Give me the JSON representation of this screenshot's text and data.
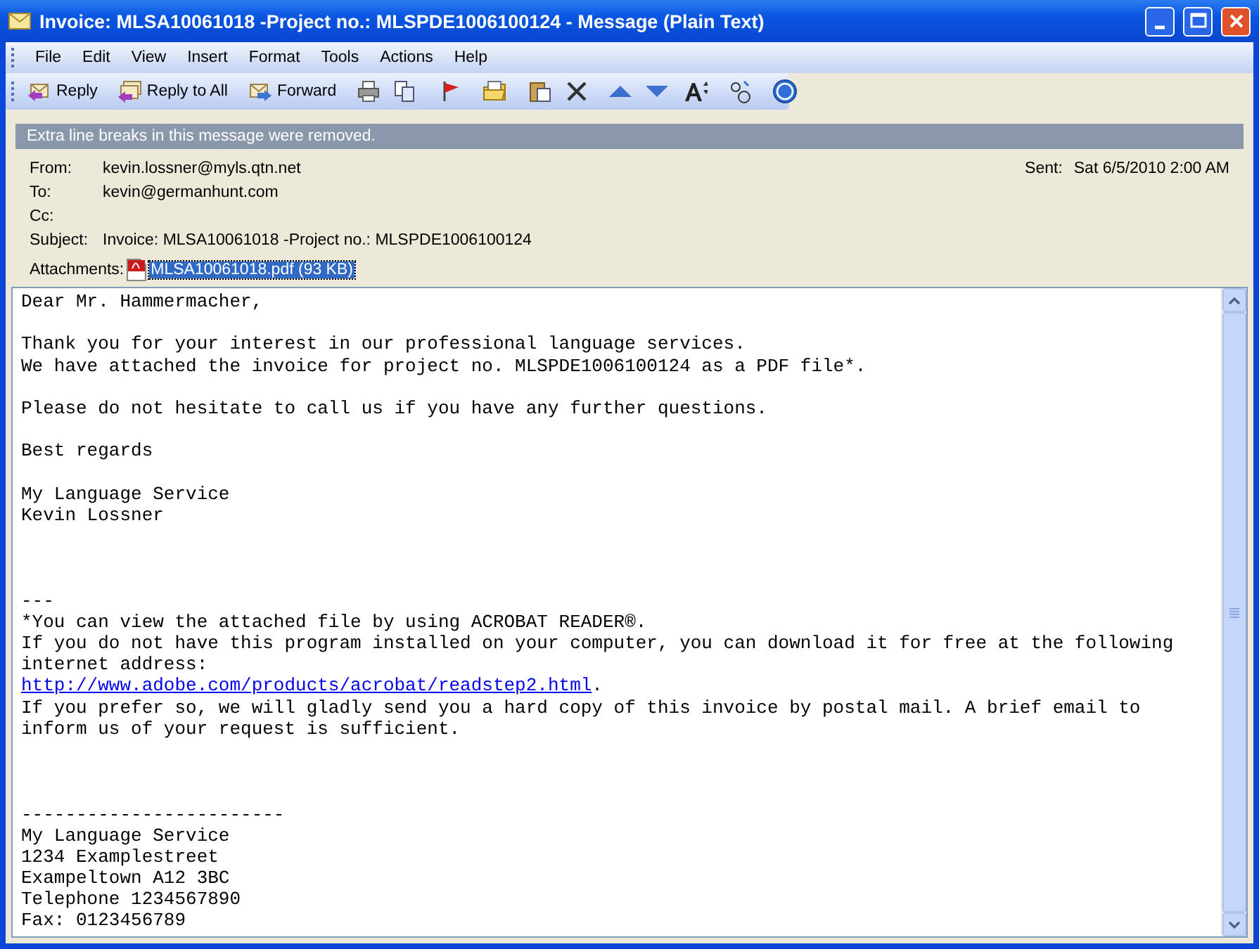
{
  "window": {
    "title": "Invoice: MLSA10061018 -Project no.: MLSPDE1006100124 - Message (Plain Text)"
  },
  "menu": [
    "File",
    "Edit",
    "View",
    "Insert",
    "Format",
    "Tools",
    "Actions",
    "Help"
  ],
  "toolbar": [
    "Reply",
    "Reply to All",
    "Forward"
  ],
  "info_bar": "Extra line breaks in this message were removed.",
  "header": {
    "from_label": "From:",
    "from": "kevin.lossner@myls.qtn.net",
    "sent_label": "Sent:",
    "sent": "Sat 6/5/2010 2:00 AM",
    "to_label": "To:",
    "to": "kevin@germanhunt.com",
    "cc_label": "Cc:",
    "subject_label": "Subject:",
    "subject": "Invoice: MLSA10061018 -Project no.: MLSPDE1006100124",
    "attachments_label": "Attachments:",
    "attachment": {
      "name": "MLSA10061018.pdf (93 KB)",
      "selected": true
    }
  },
  "body": [
    {
      "kind": "text",
      "text": "Dear Mr. Hammermacher,"
    },
    {
      "kind": "blank"
    },
    {
      "kind": "text",
      "text": "Thank you for your interest in our professional language services."
    },
    {
      "kind": "text",
      "text": "We have attached the invoice for project no. MLSPDE1006100124 as a PDF file*."
    },
    {
      "kind": "blank"
    },
    {
      "kind": "text",
      "text": "Please do not hesitate to call us if you have any further questions."
    },
    {
      "kind": "blank"
    },
    {
      "kind": "text",
      "text": "Best regards"
    },
    {
      "kind": "blank"
    },
    {
      "kind": "text",
      "text": "My Language Service"
    },
    {
      "kind": "text",
      "text": "Kevin Lossner"
    },
    {
      "kind": "blank"
    },
    {
      "kind": "blank"
    },
    {
      "kind": "blank"
    },
    {
      "kind": "text",
      "text": "---"
    },
    {
      "kind": "text",
      "text": "*You can view the attached file by using ACROBAT READER®."
    },
    {
      "kind": "text",
      "text": "If you do not have this program installed on your computer, you can download it for free at the following"
    },
    {
      "kind": "text",
      "text": "internet address:"
    },
    {
      "kind": "link",
      "text": "http://www.adobe.com/products/acrobat/readstep2.html",
      "after": "."
    },
    {
      "kind": "text",
      "text": "If you prefer so, we will gladly send you a hard copy of this invoice by postal mail. A brief email to"
    },
    {
      "kind": "text",
      "text": "inform us of your request is sufficient."
    },
    {
      "kind": "blank"
    },
    {
      "kind": "blank"
    },
    {
      "kind": "blank"
    },
    {
      "kind": "text",
      "text": "------------------------"
    },
    {
      "kind": "text",
      "text": "My Language Service"
    },
    {
      "kind": "text",
      "text": "1234 Examplestreet"
    },
    {
      "kind": "text",
      "text": "Exampeltown A12 3BC"
    },
    {
      "kind": "text",
      "text": "Telephone 1234567890"
    },
    {
      "kind": "text",
      "text": "Fax: 0123456789"
    }
  ]
}
